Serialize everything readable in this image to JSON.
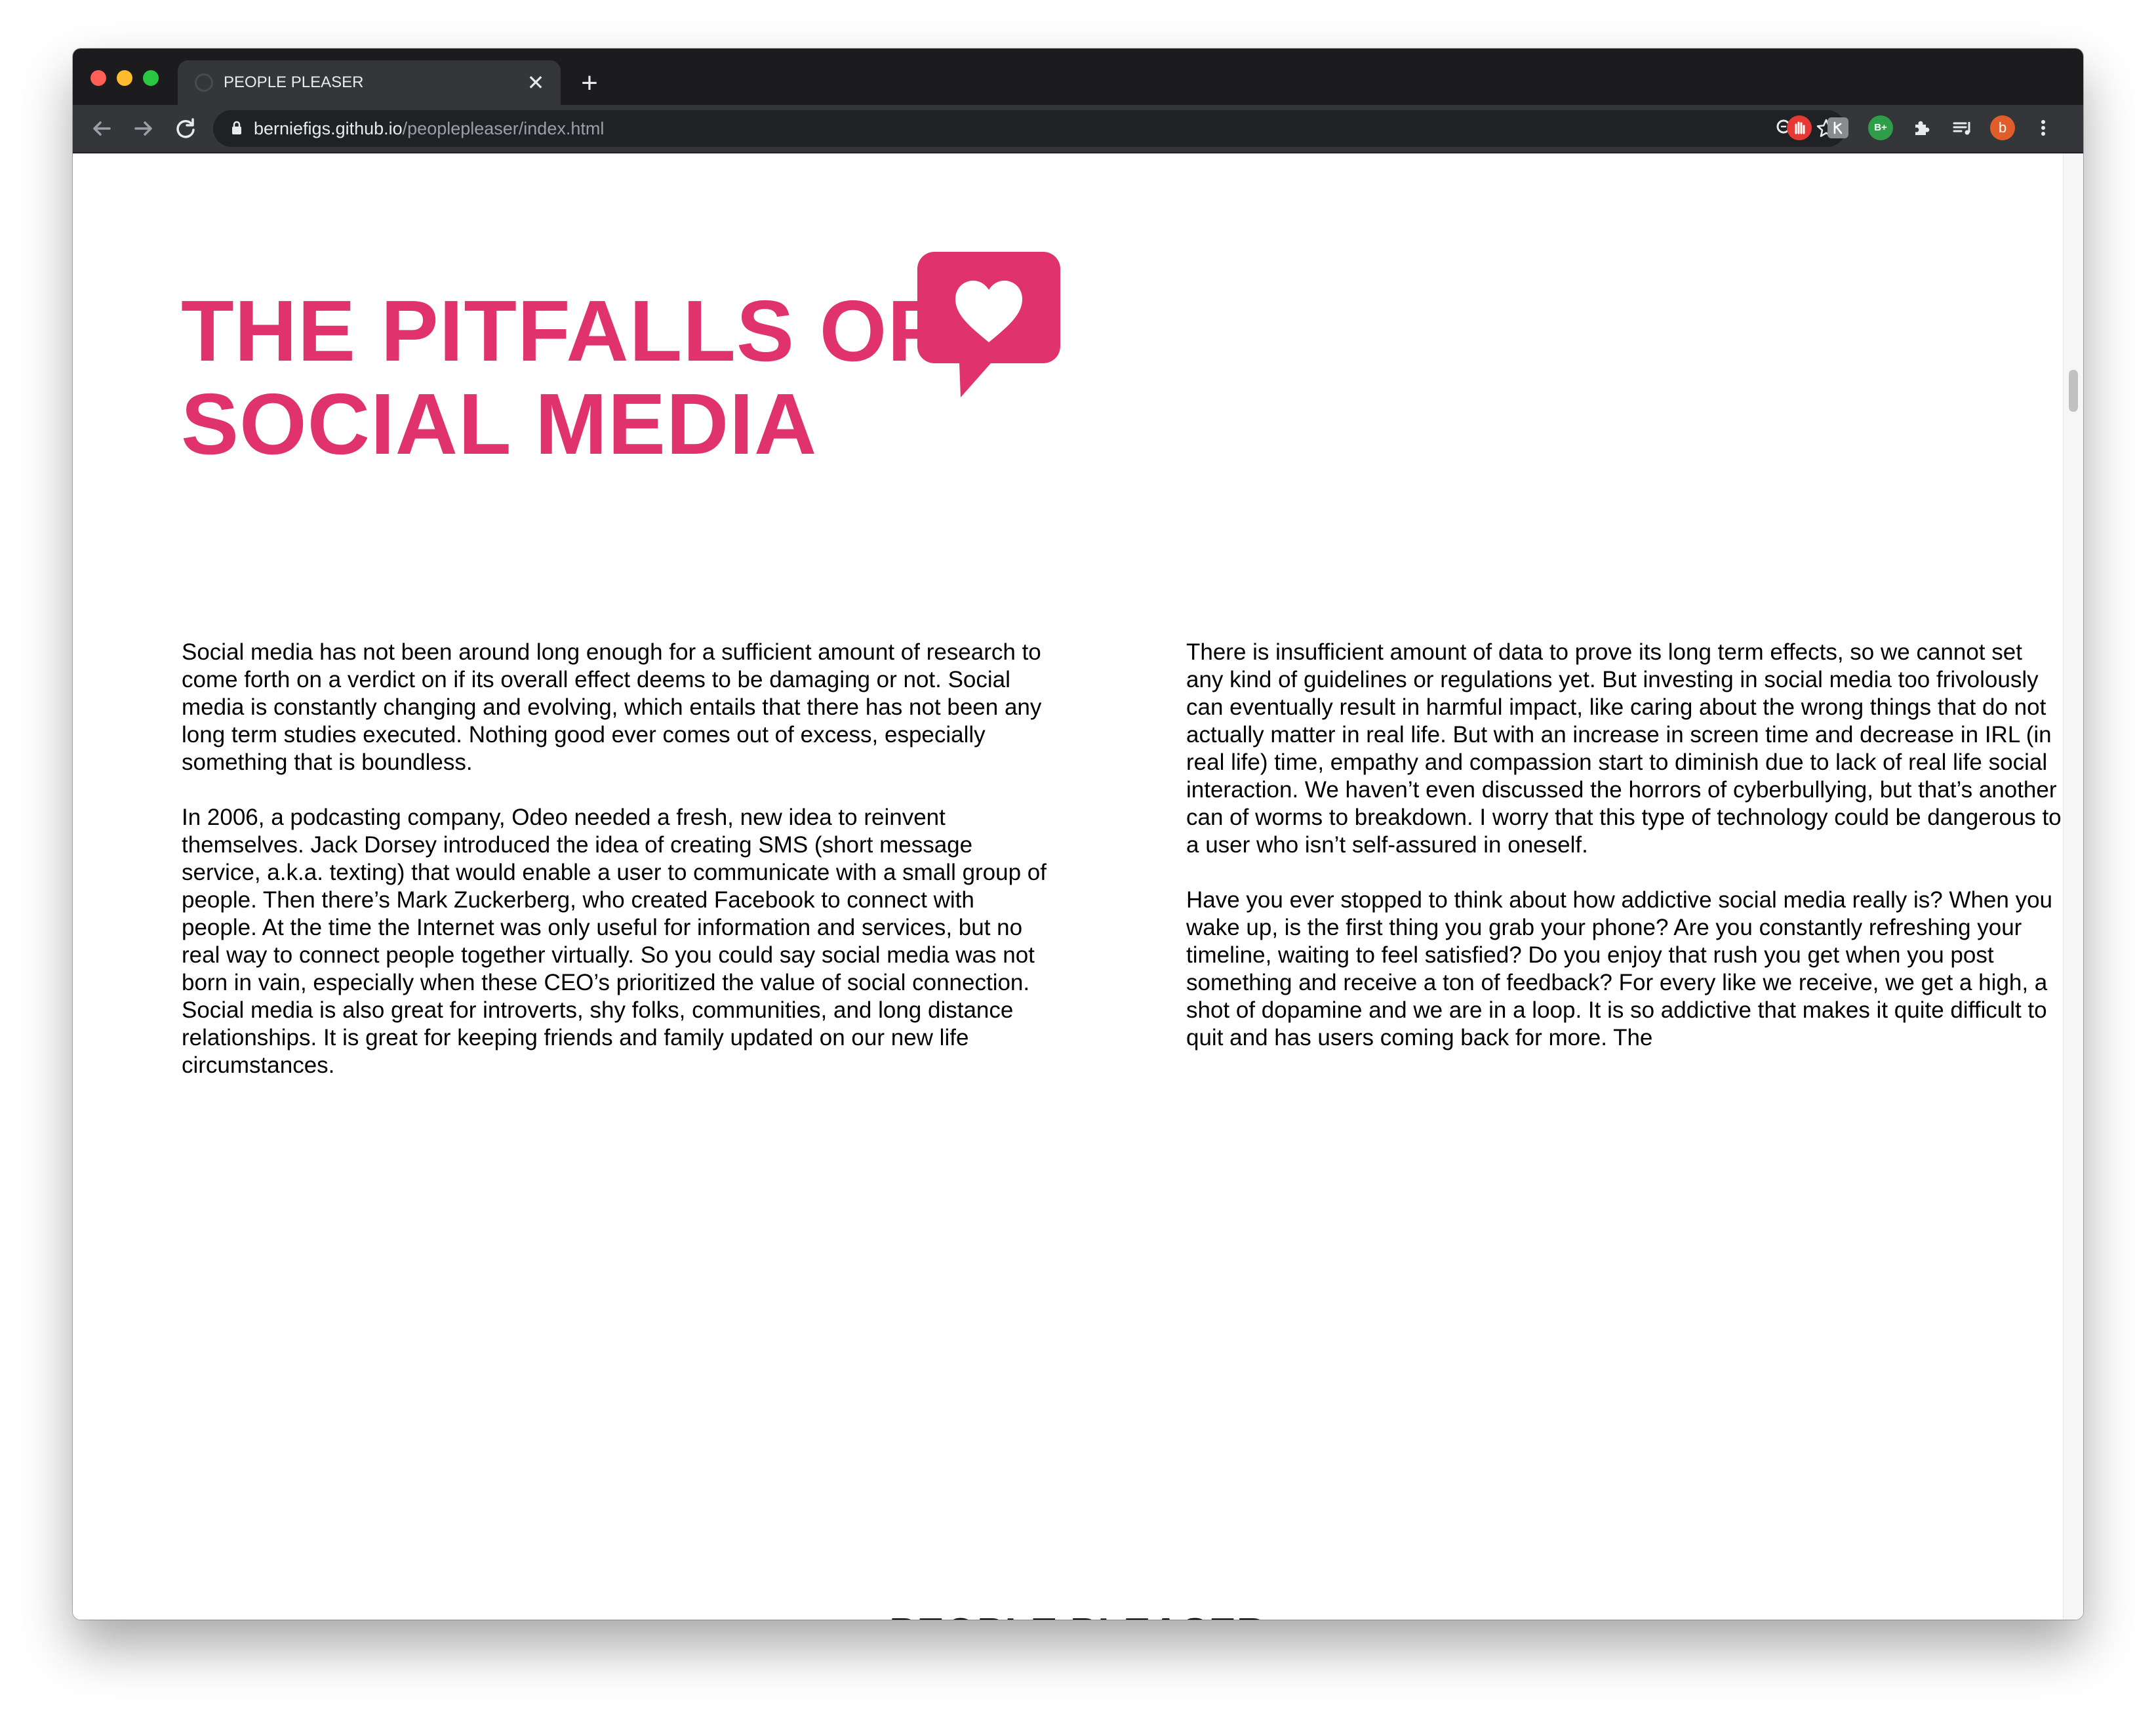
{
  "browser": {
    "tab_title": "PEOPLE PLEASER",
    "tab_close_glyph": "✕",
    "new_tab_glyph": "+",
    "url_host": "berniefigs.github.io",
    "url_path": "/peoplepleaser/index.html",
    "extensions": {
      "green_badge": "B+",
      "avatar_letter": "b"
    },
    "icons": [
      "back-arrow-icon",
      "forward-arrow-icon",
      "reload-icon",
      "lock-icon",
      "zoom-icon",
      "star-icon",
      "adblock-icon",
      "extension-icon",
      "puzzle-icon",
      "media-icon",
      "profile-avatar",
      "kebab-menu-icon"
    ]
  },
  "page": {
    "title_line1": "THE PITFALLS OF",
    "title_line2": "SOCIAL MEDIA",
    "accent_color": "#e0336d",
    "left_column": [
      "Social media has not been around long enough for a sufficient amount of research to come forth on a verdict on if its overall effect deems to be damaging or not. Social media is constantly changing and evolving, which entails that there has not been any long term studies executed. Nothing good ever comes out of excess, especially something that is boundless.",
      "In 2006, a podcasting company, Odeo needed a fresh, new idea to reinvent themselves. Jack Dorsey introduced the idea of creating SMS (short message service, a.k.a. texting) that would enable a user to communicate with a small group of people. Then there’s Mark Zuckerberg, who created Facebook to connect with people. At the time the Internet was only useful for information and services, but no real way to connect people together virtually. So you could say social media was not born in vain, especially when these CEO’s prioritized the value of social connection. Social media is also great for introverts, shy folks, communities, and long distance relationships. It is great for keeping friends and family updated on our new life circumstances."
    ],
    "right_column": [
      "There is insufficient amount of data to prove its long term effects, so we cannot set any kind of guidelines or regulations yet. But investing in social media too frivolously can eventually result in harmful impact, like caring about the wrong things that do not actually matter in real life. But with an increase in screen time and decrease in IRL (in real life) time, empathy and compassion start to diminish due to lack of real life social interaction. We haven’t even discussed the horrors of cyberbullying, but that’s another can of worms to breakdown. I worry that this type of technology could be dangerous to a user who isn’t self-assured in oneself.",
      "Have you ever stopped to think about how addictive social media really is? When you wake up, is the first thing you grab your phone? Are you constantly refreshing your timeline, waiting to feel satisfied? Do you enjoy that rush you get when you post something and receive a ton of feedback? For every like we receive, we get a high, a shot of dopamine and we are in a loop. It is so addictive that makes it quite difficult to quit and has users coming back for more. The"
    ],
    "footer_brand": "PEOPLE PLEASER"
  }
}
